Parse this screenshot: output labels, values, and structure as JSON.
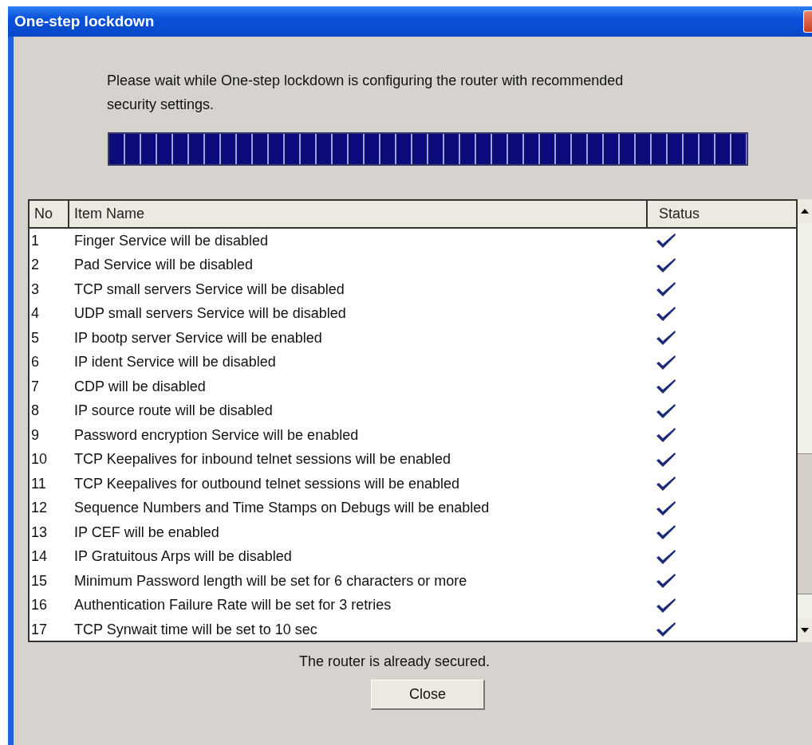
{
  "window": {
    "title": "One-step lockdown"
  },
  "message": "Please wait while One-step lockdown is configuring the router with recommended security settings.",
  "progress": {
    "level": 1
  },
  "table": {
    "columns": [
      "No",
      "Item Name",
      "Status"
    ],
    "rows": [
      {
        "no": "1",
        "item": "Finger Service will be disabled",
        "done": true
      },
      {
        "no": "2",
        "item": "Pad Service will be disabled",
        "done": true
      },
      {
        "no": "3",
        "item": "TCP small servers Service will be disabled",
        "done": true
      },
      {
        "no": "4",
        "item": "UDP small servers Service will be disabled",
        "done": true
      },
      {
        "no": "5",
        "item": "IP bootp server Service  will be enabled",
        "done": true
      },
      {
        "no": "6",
        "item": "IP ident Service will be disabled",
        "done": true
      },
      {
        "no": "7",
        "item": "CDP will be disabled",
        "done": true
      },
      {
        "no": "8",
        "item": "IP source route will be disabled",
        "done": true
      },
      {
        "no": "9",
        "item": "Password encryption Service will be enabled",
        "done": true
      },
      {
        "no": "10",
        "item": "TCP Keepalives for inbound telnet sessions will be enabled",
        "done": true
      },
      {
        "no": "11",
        "item": "TCP Keepalives for outbound telnet sessions will be enabled",
        "done": true
      },
      {
        "no": "12",
        "item": "Sequence Numbers and Time Stamps on Debugs will be enabled",
        "done": true
      },
      {
        "no": "13",
        "item": "IP CEF will be enabled",
        "done": true
      },
      {
        "no": "14",
        "item": "IP Gratuitous Arps will be disabled",
        "done": true
      },
      {
        "no": "15",
        "item": "Minimum Password length will be set for 6 characters or more",
        "done": true
      },
      {
        "no": "16",
        "item": "Authentication Failure Rate will be set for 3 retries",
        "done": true
      },
      {
        "no": "17",
        "item": "TCP Synwait time will be set to 10 sec",
        "done": true
      }
    ]
  },
  "status_message": "The router is already secured.",
  "buttons": [
    "Close"
  ]
}
